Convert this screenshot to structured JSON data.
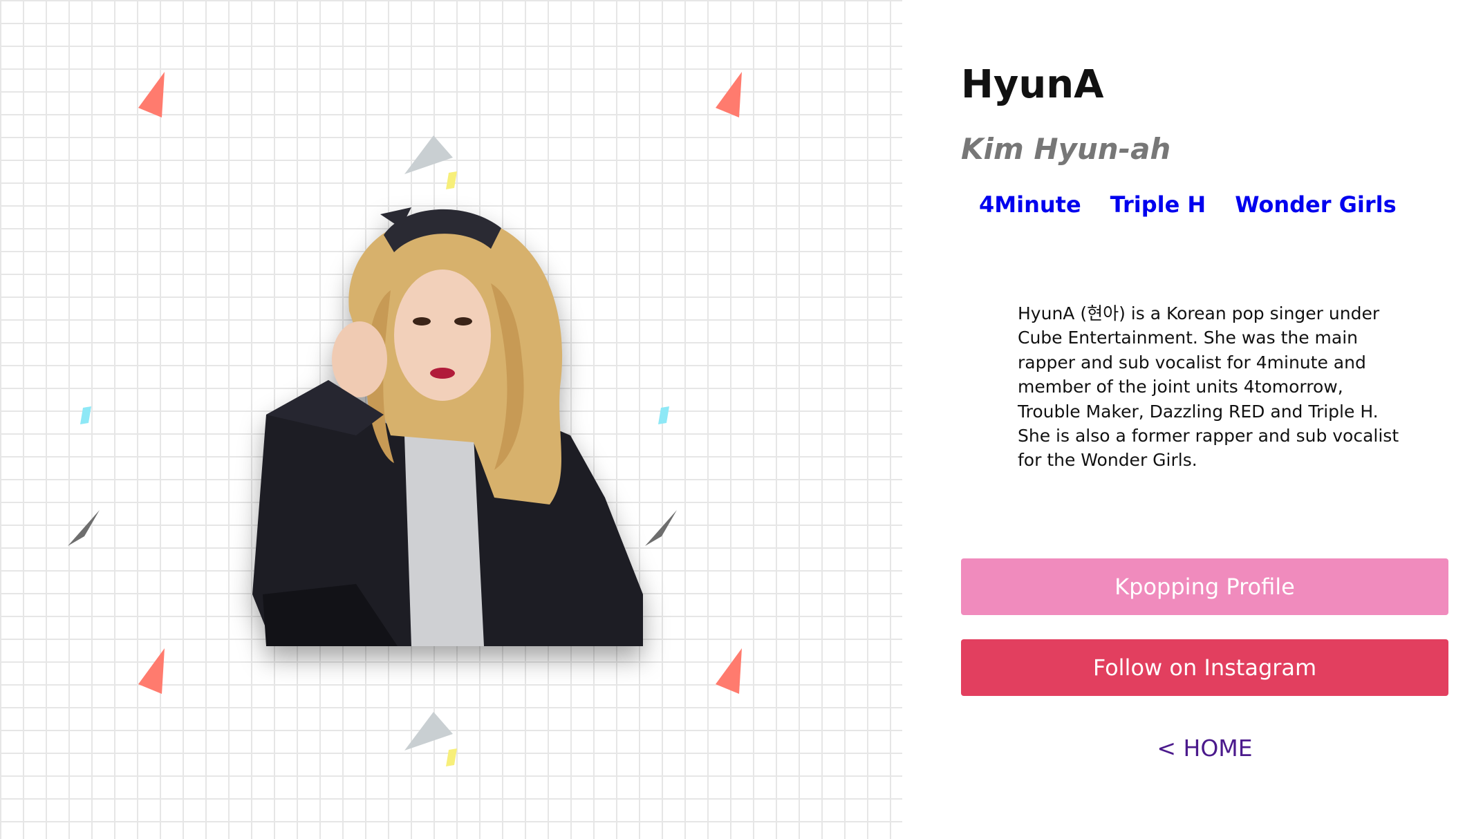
{
  "artist": {
    "stage_name": "HyunA",
    "real_name": "Kim Hyun-ah",
    "groups": [
      "4Minute",
      "Triple H",
      "Wonder Girls"
    ],
    "bio": "HyunA (현아) is a Korean pop singer under Cube Entertainment. She was the main rapper and sub vocalist for 4minute and member of the joint units 4tomorrow, Trouble Maker, Dazzling RED and Triple H. She is also a former rapper and sub vocalist for the Wonder Girls."
  },
  "actions": {
    "profile_label": "Kpopping Profile",
    "instagram_label": "Follow on Instagram",
    "home_label": "< HOME"
  },
  "colors": {
    "profile_button": "#f08bbd",
    "instagram_button": "#e23f5f",
    "group_links": "#0000ee",
    "home_link": "#4b1a8c",
    "confetti_red": "#ff7b6e",
    "confetti_gray": "#c9cfd2",
    "confetti_dark": "#6e6e6e",
    "confetti_yellow": "#f7ef7a",
    "confetti_cyan": "#8ee8f6"
  },
  "image": {
    "alt": "HyunA"
  }
}
